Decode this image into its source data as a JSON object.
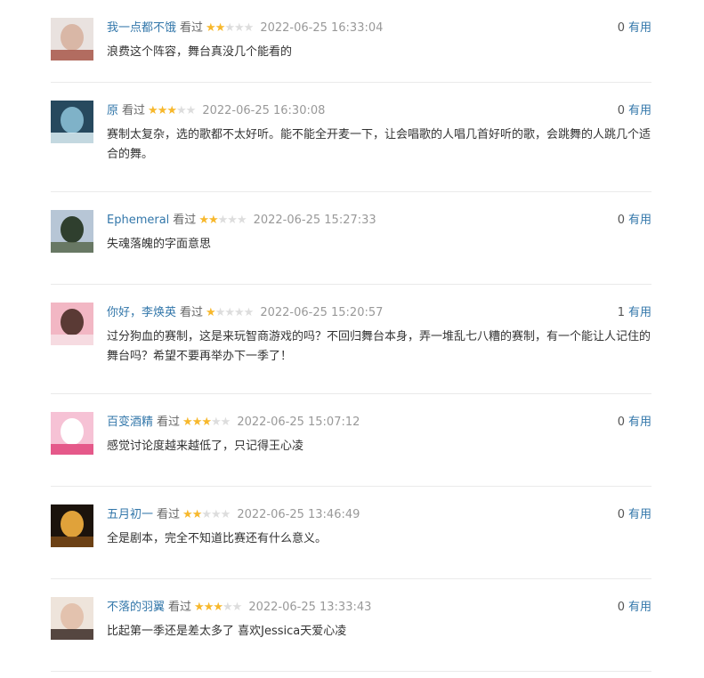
{
  "comments": [
    {
      "author": "我一点都不饿",
      "action": "看过",
      "rating": 2,
      "time": "2022-06-25 16:33:04",
      "votes": "0",
      "useful_label": "有用",
      "content": "浪费这个阵容，舞台真没几个能看的",
      "avatar_colors": [
        "#e9e2df",
        "#d9b7a6",
        "#a8574a"
      ]
    },
    {
      "author": "原",
      "action": "看过",
      "rating": 3,
      "time": "2022-06-25 16:30:08",
      "votes": "0",
      "useful_label": "有用",
      "content": "赛制太复杂，选的歌都不太好听。能不能全开麦一下，让会唱歌的人唱几首好听的歌，会跳舞的人跳几个适合的舞。",
      "avatar_colors": [
        "#27495e",
        "#7fb2c8",
        "#dff1f7"
      ]
    },
    {
      "author": "Ephemeral",
      "action": "看过",
      "rating": 2,
      "time": "2022-06-25 15:27:33",
      "votes": "0",
      "useful_label": "有用",
      "content": "失魂落魄的字面意思",
      "avatar_colors": [
        "#b7c6d6",
        "#2f3f2e",
        "#5b6a50"
      ]
    },
    {
      "author": "你好，李焕英",
      "action": "看过",
      "rating": 1,
      "time": "2022-06-25 15:20:57",
      "votes": "1",
      "useful_label": "有用",
      "content": "过分狗血的赛制，这是来玩智商游戏的吗？不回归舞台本身，弄一堆乱七八糟的赛制，有一个能让人记住的舞台吗？希望不要再举办下一季了！",
      "avatar_colors": [
        "#f2b7c4",
        "#5a3a35",
        "#f7e2e6"
      ]
    },
    {
      "author": "百变酒精",
      "action": "看过",
      "rating": 3,
      "time": "2022-06-25 15:07:12",
      "votes": "0",
      "useful_label": "有用",
      "content": "感觉讨论度越来越低了，只记得王心凌",
      "avatar_colors": [
        "#f6c2d5",
        "#ffffff",
        "#e2467d"
      ]
    },
    {
      "author": "五月初一",
      "action": "看过",
      "rating": 2,
      "time": "2022-06-25 13:46:49",
      "votes": "0",
      "useful_label": "有用",
      "content": "全是剧本，完全不知道比赛还有什么意义。",
      "avatar_colors": [
        "#1b130c",
        "#e0a23a",
        "#7a4a17"
      ]
    },
    {
      "author": "不落的羽翼",
      "action": "看过",
      "rating": 3,
      "time": "2022-06-25 13:33:43",
      "votes": "0",
      "useful_label": "有用",
      "content": "比起第一季还是差太多了 喜欢Jessica天爱心凌",
      "avatar_colors": [
        "#eee4db",
        "#e3c2ae",
        "#3a2a24"
      ]
    }
  ]
}
